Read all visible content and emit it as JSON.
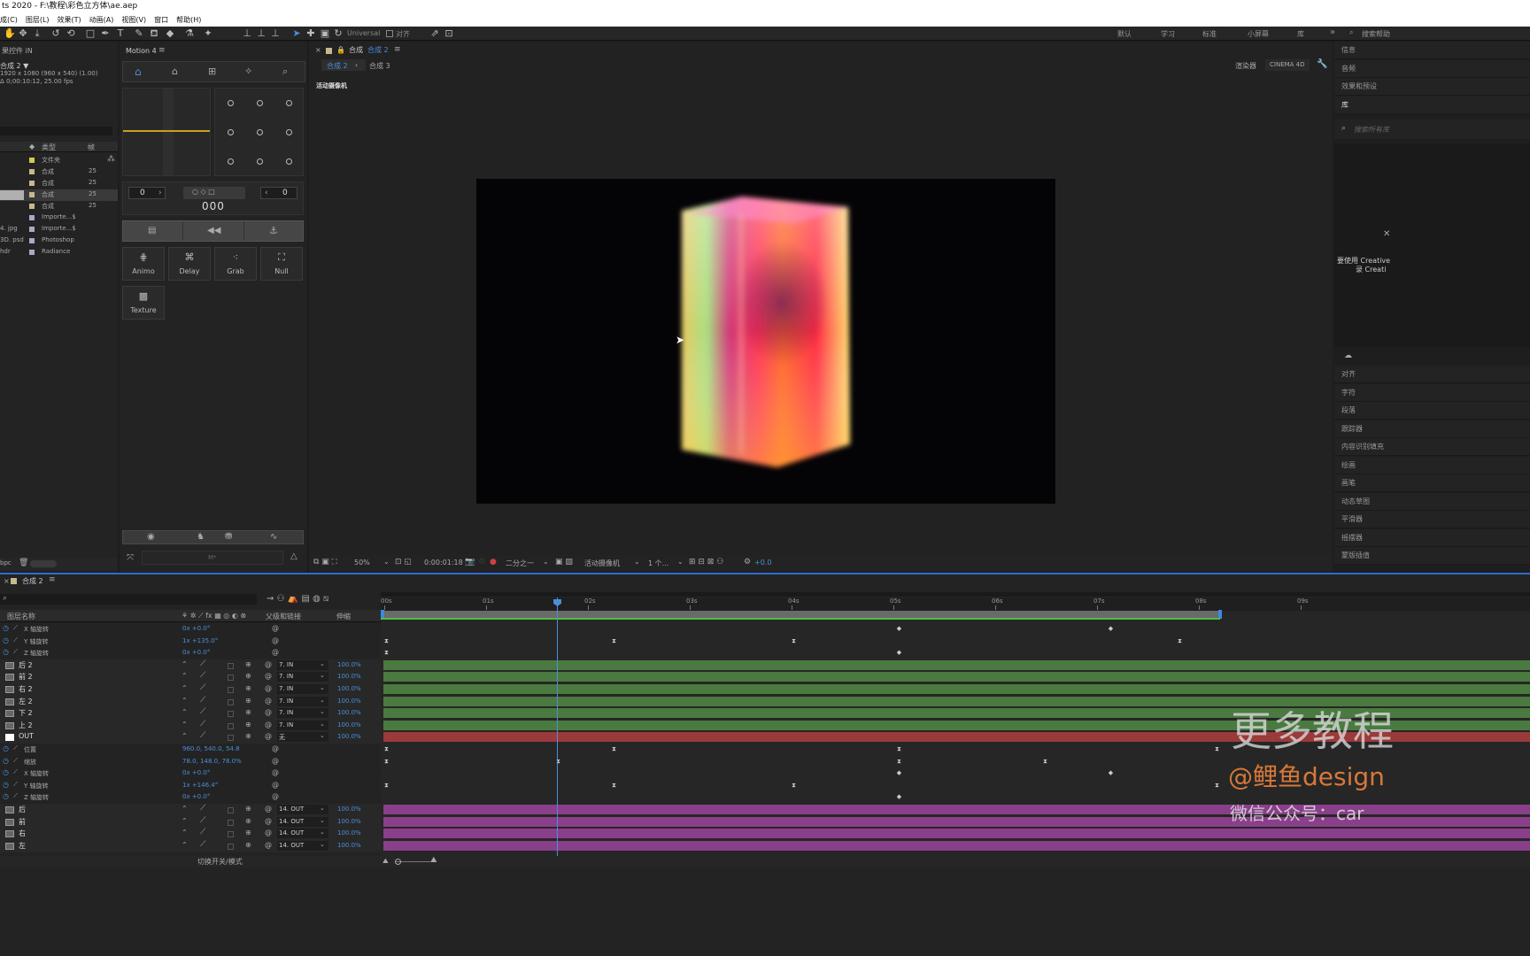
{
  "window": {
    "title": "ts 2020 - F:\\教程\\彩色立方体\\ae.aep"
  },
  "menu": [
    "成(C)",
    "图层(L)",
    "效果(T)",
    "动画(A)",
    "视图(V)",
    "窗口",
    "帮助(H)"
  ],
  "toolbar": {
    "universal": "Universal",
    "align": "对齐"
  },
  "workspaces": [
    "默认",
    "学习",
    "标准",
    "小屏幕",
    "库"
  ],
  "search": {
    "label": "搜索帮助"
  },
  "project": {
    "header": "果控件 iN",
    "comp_name": "合成 2 ▼",
    "comp_info": "1920 x 1080 (960 x 540) (1.00)",
    "comp_dur": "Δ 0;00:10:12, 25.00 fps",
    "col_type": "类型",
    "col_size": "帧",
    "items": [
      {
        "name": "",
        "type": "文件夹",
        "size": "",
        "color": "#d8c84a"
      },
      {
        "name": "",
        "type": "合成",
        "size": "25",
        "color": "#c8b890"
      },
      {
        "name": "",
        "type": "合成",
        "size": "25",
        "color": "#c8b890"
      },
      {
        "name": "",
        "type": "合成",
        "size": "25",
        "color": "#c8b890"
      },
      {
        "name": "",
        "type": "合成",
        "size": "25",
        "color": "#c8b890"
      },
      {
        "name": "",
        "type": "Importe...$",
        "size": "",
        "color": "#a9a9c8"
      },
      {
        "name": "4. jpg",
        "type": "Importe...$",
        "size": "",
        "color": "#a9a9c8"
      },
      {
        "name": "3D. psd",
        "type": "Photoshop",
        "size": "",
        "color": "#a9a9c8"
      },
      {
        "name": "hdr",
        "type": "Radiance",
        "size": "",
        "color": "#a9a9c8"
      }
    ],
    "bpc": "bpc"
  },
  "motion": {
    "title": "Motion 4",
    "val_left": "0",
    "val_right": "0",
    "counter": "000",
    "buttons": [
      "Animo",
      "Delay",
      "Grab",
      "Null"
    ],
    "texture": "Texture",
    "mbox": "M*"
  },
  "comp": {
    "tab_label": "合成",
    "tab_name": "合成 2",
    "sub1": "合成 2",
    "sub2": "合成 3",
    "camera": "活动摄像机",
    "renderer": "渲染器",
    "renderer_val": "CINEMA 4D"
  },
  "viewer_bar": {
    "zoom": "50%",
    "time": "0:00:01:18",
    "res": "二分之一",
    "camera": "活动摄像机",
    "views": "1 个...",
    "exposure": "+0.0"
  },
  "right_panel": {
    "items": [
      "信息",
      "音频",
      "效果和预设",
      "库"
    ],
    "search_ph": "搜索所有库",
    "cc_msg1": "要使用 Creative",
    "cc_msg2": "录 Creati",
    "items2": [
      "对齐",
      "字符",
      "段落",
      "跟踪器",
      "内容识别填充",
      "绘画",
      "画笔",
      "动态草图",
      "平滑器",
      "摇摆器",
      "蒙版插值"
    ]
  },
  "timeline": {
    "tab": "合成 2",
    "col_name": "图层名称",
    "col_parent": "父级和链接",
    "col_stretch": "伸缩",
    "toggle": "切换开关/模式",
    "ruler": [
      "00s",
      "01s",
      "02s",
      "03s",
      "04s",
      "05s",
      "06s",
      "07s",
      "08s",
      "09s"
    ],
    "layers": [
      {
        "name": "X 轴旋转",
        "value": "0x +0.0°",
        "kind": "prop"
      },
      {
        "name": "Y 轴旋转",
        "value": "1x +135.0°",
        "kind": "prop"
      },
      {
        "name": "Z 轴旋转",
        "value": "0x +0.0°",
        "kind": "prop"
      },
      {
        "name": "后 2",
        "parent": "7. IN",
        "stretch": "100.0%",
        "kind": "layer"
      },
      {
        "name": "前 2",
        "parent": "7. IN",
        "stretch": "100.0%",
        "kind": "layer"
      },
      {
        "name": "右 2",
        "parent": "7. IN",
        "stretch": "100.0%",
        "kind": "layer"
      },
      {
        "name": "左 2",
        "parent": "7. IN",
        "stretch": "100.0%",
        "kind": "layer"
      },
      {
        "name": "下 2",
        "parent": "7. IN",
        "stretch": "100.0%",
        "kind": "layer"
      },
      {
        "name": "上 2",
        "parent": "7. IN",
        "stretch": "100.0%",
        "kind": "layer"
      },
      {
        "name": "OUT",
        "parent": "无",
        "stretch": "100.0%",
        "kind": "null"
      },
      {
        "name": "位置",
        "value": "960.0, 540.0, 54.8",
        "kind": "prop"
      },
      {
        "name": "缩放",
        "value": "78.0, 148.0, 78.0%",
        "kind": "prop"
      },
      {
        "name": "X 轴旋转",
        "value": "0x +0.0°",
        "kind": "prop"
      },
      {
        "name": "Y 轴旋转",
        "value": "1x +146.4°",
        "kind": "prop"
      },
      {
        "name": "Z 轴旋转",
        "value": "0x +0.0°",
        "kind": "prop"
      },
      {
        "name": "后",
        "parent": "14. OUT",
        "stretch": "100.0%",
        "kind": "layer"
      },
      {
        "name": "前",
        "parent": "14. OUT",
        "stretch": "100.0%",
        "kind": "layer"
      },
      {
        "name": "右",
        "parent": "14. OUT",
        "stretch": "100.0%",
        "kind": "layer"
      },
      {
        "name": "左",
        "parent": "14. OUT",
        "stretch": "100.0%",
        "kind": "layer"
      }
    ]
  },
  "watermark": {
    "line1": "更多教程",
    "line2": "@鲤鱼design",
    "line3": "微信公众号：car"
  }
}
